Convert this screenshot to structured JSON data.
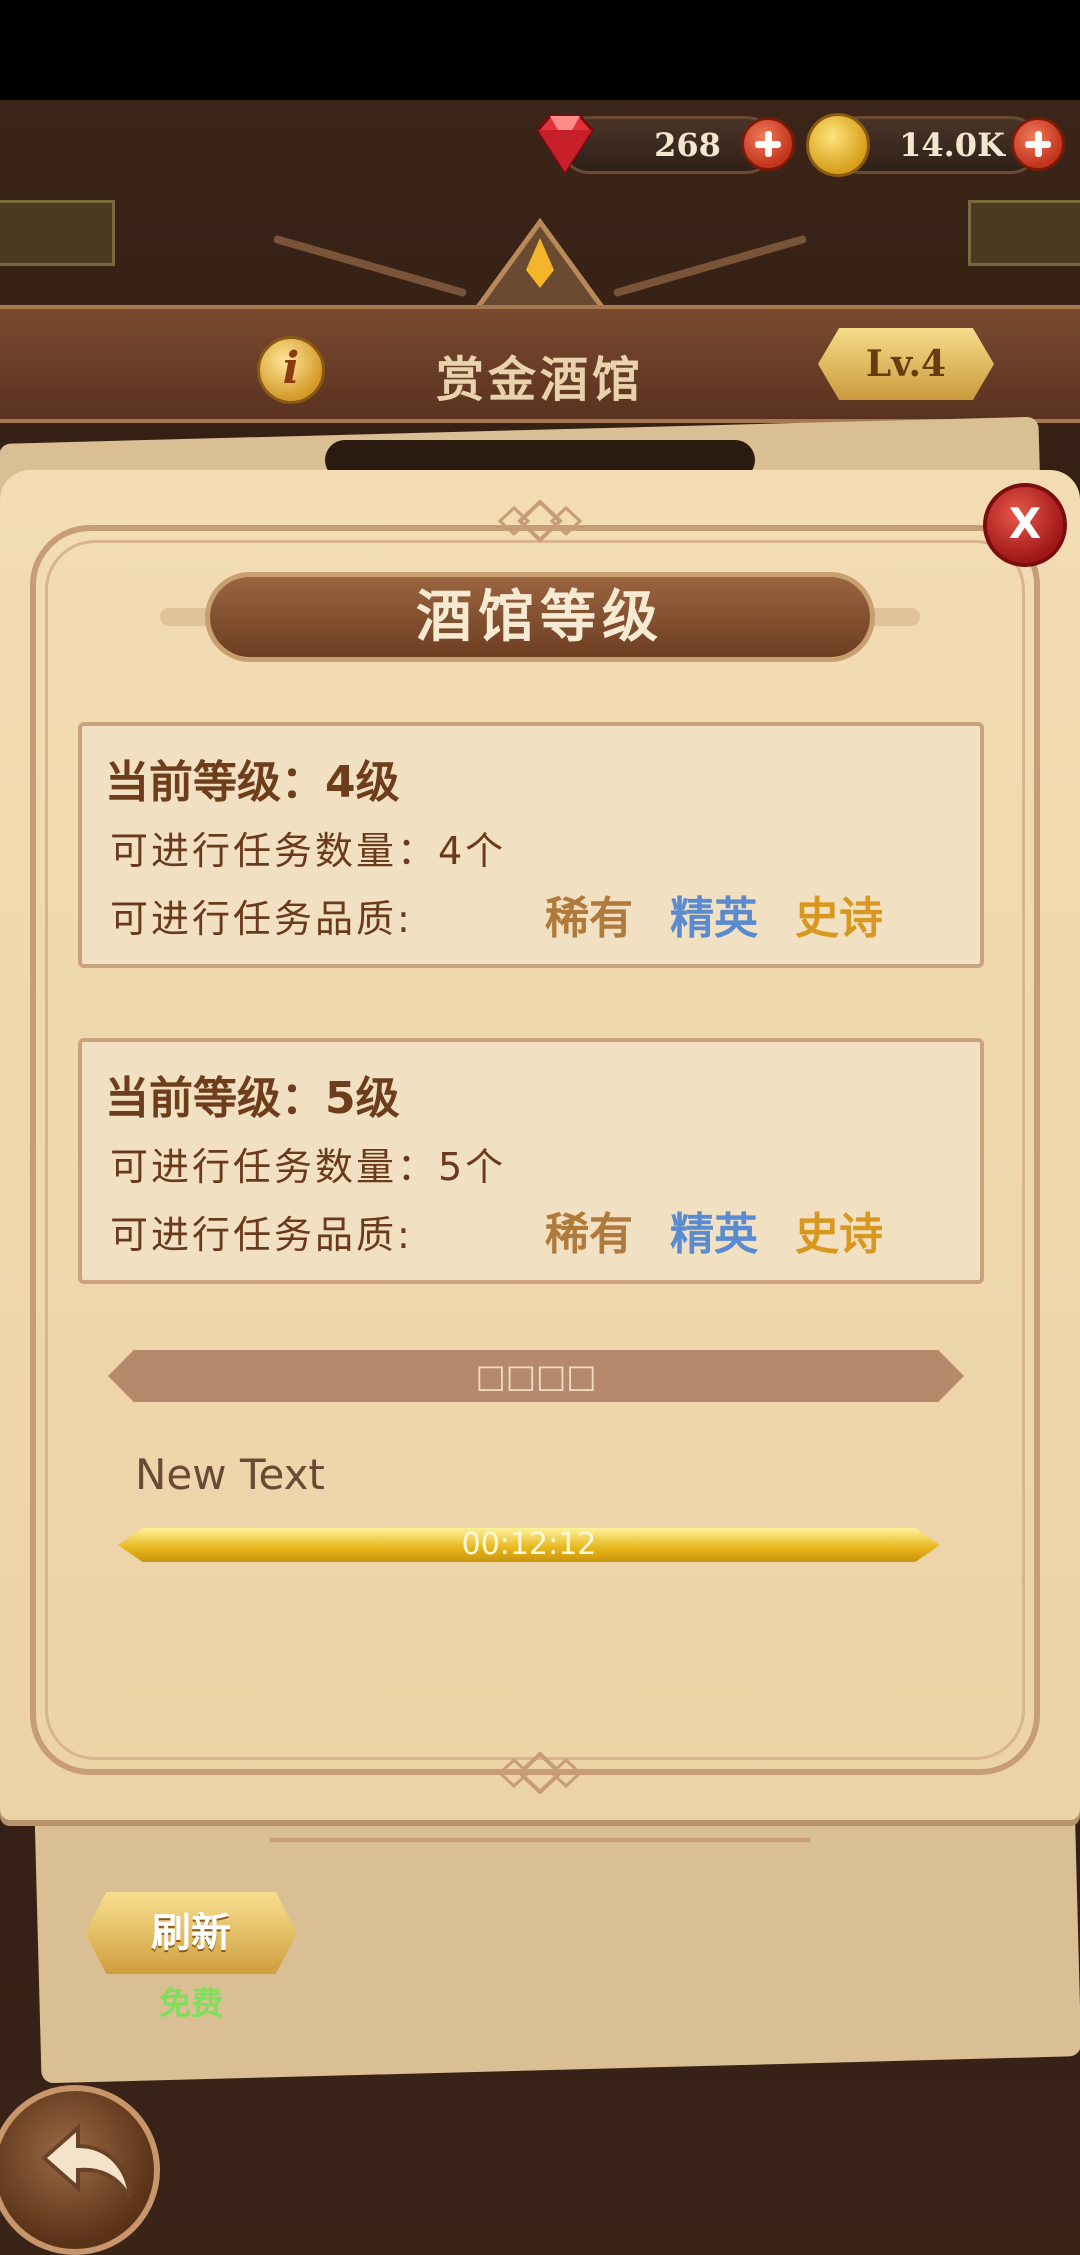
{
  "resources": {
    "gems": "268",
    "gold": "14.0K"
  },
  "header": {
    "title": "赏金酒馆",
    "info_label": "i",
    "level_badge": "Lv.4"
  },
  "modal": {
    "title": "酒馆等级",
    "close_label": "X",
    "levels": [
      {
        "title": "当前等级：4级",
        "count_line": "可进行任务数量：4个",
        "quality_label": "可进行任务品质:",
        "qualities": [
          "稀有",
          "精英",
          "史诗"
        ]
      },
      {
        "title": "当前等级：5级",
        "count_line": "可进行任务数量：5个",
        "quality_label": "可进行任务品质:",
        "qualities": [
          "稀有",
          "精英",
          "史诗"
        ]
      }
    ],
    "divider_label": "□□□□",
    "new_text": "New Text",
    "timer": "00:12:12",
    "progress_fraction": 1.0
  },
  "bottom": {
    "refresh_label": "刷新",
    "refresh_cost": "免费"
  },
  "colors": {
    "rare": "#b07a3c",
    "elite": "#5a8ad0",
    "epic": "#d89820"
  }
}
